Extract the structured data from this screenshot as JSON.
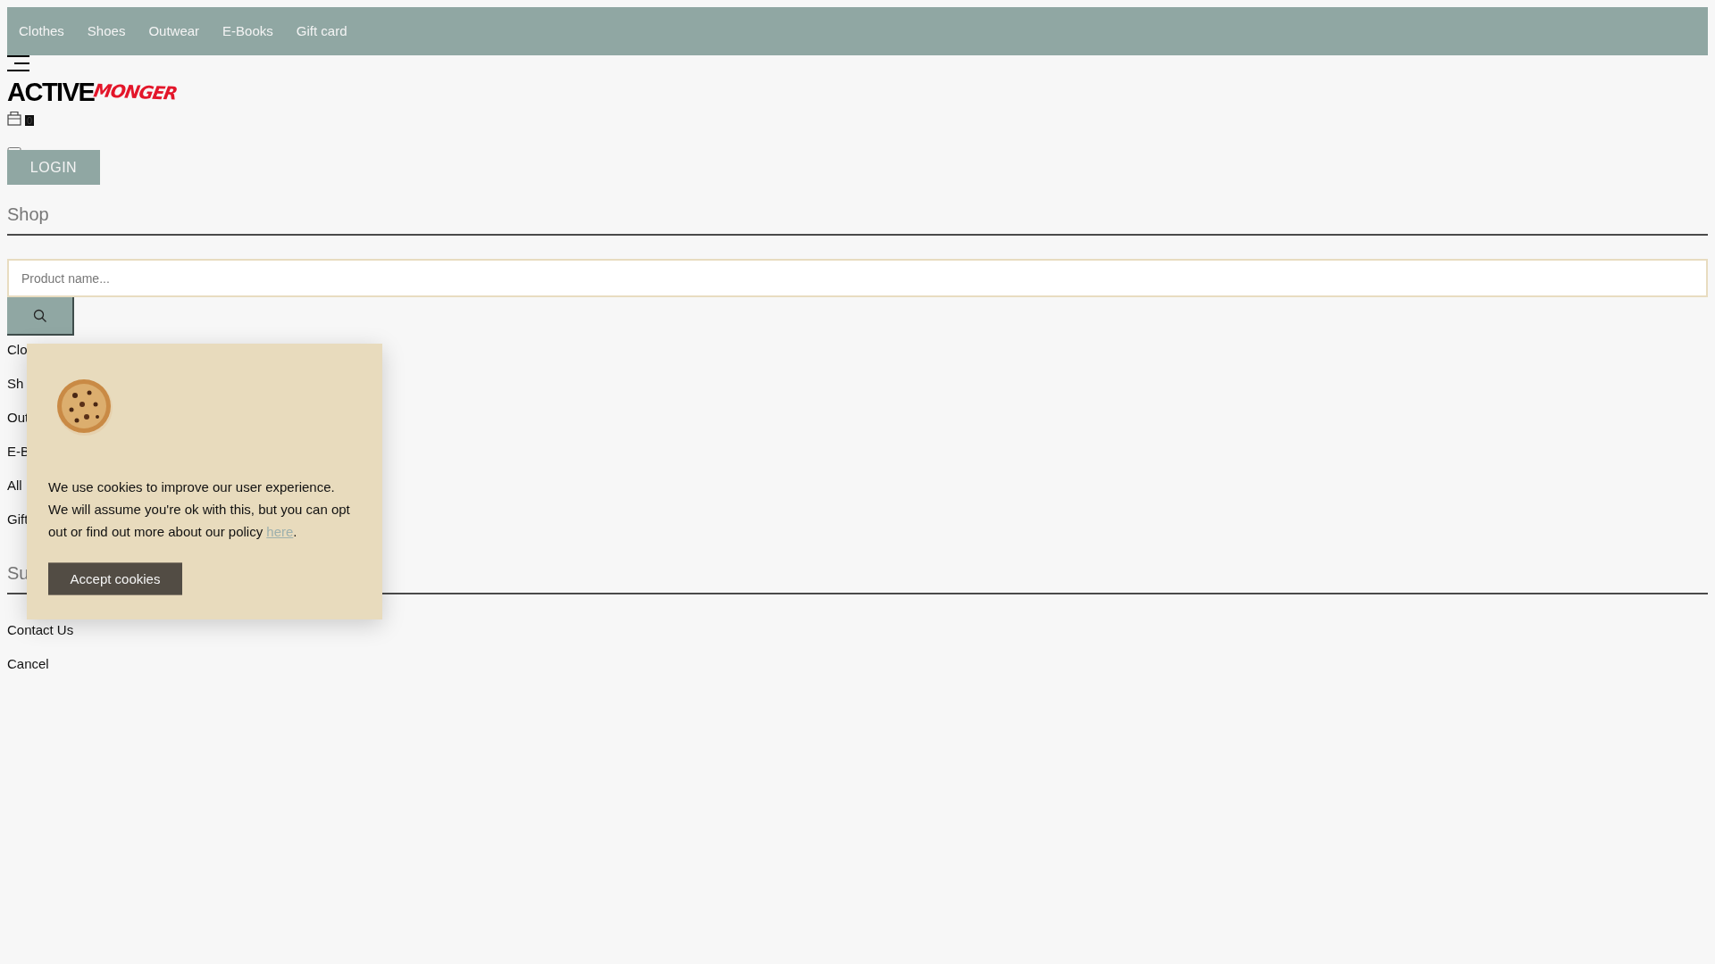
{
  "nav": {
    "items": [
      "Clothes",
      "Shoes",
      "Outwear",
      "E-Books",
      "Gift card"
    ]
  },
  "header": {
    "logo": {
      "bold": "ACTIVE",
      "script": "MONGER"
    },
    "cart_count": "0",
    "login": "LOGIN"
  },
  "shop": {
    "title": "Shop",
    "search": {
      "placeholder": "Product name..."
    },
    "categories": [
      "Clo",
      "Sh",
      "Out",
      "E-B",
      "All",
      "Gift"
    ]
  },
  "support": {
    "title": "Su",
    "links": [
      "Contact Us",
      "Cancel"
    ]
  },
  "cookie_notice": {
    "message": "We use cookies to improve our user experience. We will assume you're ok with this, but you can opt out or find out more about our policy ",
    "link": "here",
    "message_end": ".",
    "button": "Accept cookies"
  }
}
